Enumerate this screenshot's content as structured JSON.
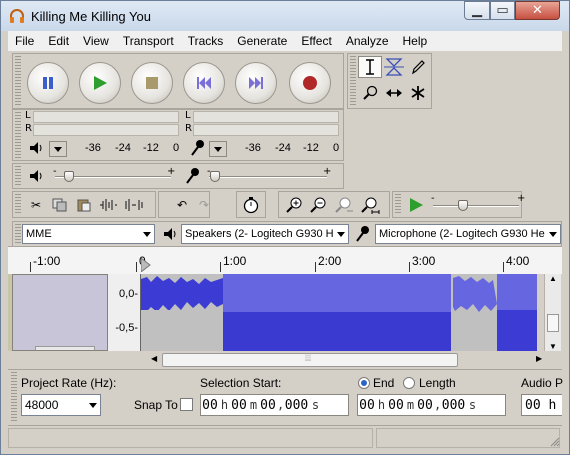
{
  "window": {
    "title": "Killing Me Killing You"
  },
  "menu": [
    "File",
    "Edit",
    "View",
    "Transport",
    "Tracks",
    "Generate",
    "Effect",
    "Analyze",
    "Help"
  ],
  "meters": {
    "play_L": "L",
    "play_R": "R",
    "rec_L": "L",
    "rec_R": "R",
    "play_scale": [
      "-36",
      "-24",
      "-12",
      "0"
    ],
    "rec_scale": [
      "-36",
      "-24",
      "-12",
      "0"
    ]
  },
  "mixer": {
    "output_volume_fraction": 0.12,
    "input_volume_fraction": 0.05,
    "minus": "-",
    "plus": "+"
  },
  "devices": {
    "host": "MME",
    "output": "Speakers (2- Logitech G930 He",
    "input": "Microphone (2- Logitech G930 He"
  },
  "play_at_speed": {
    "speed_fraction": 0.35,
    "minus": "-",
    "plus": "+"
  },
  "ruler": {
    "labels": [
      "-1:00",
      "0",
      "1:00",
      "2:00",
      "3:00",
      "4:00"
    ]
  },
  "track": {
    "y_labels": [
      "0,0-",
      "-0,5-"
    ]
  },
  "selection_toolbar": {
    "project_rate_label": "Project Rate (Hz):",
    "project_rate_value": "48000",
    "snap_to_label": "Snap To",
    "selection_start_label": "Selection Start:",
    "end_label": "End",
    "length_label": "Length",
    "audio_position_label": "Audio P",
    "start_time": [
      "00",
      "h",
      "00",
      "m",
      "00",
      ",",
      "000",
      "s"
    ],
    "end_time": [
      "00",
      "h",
      "00",
      "m",
      "00",
      ",",
      "000",
      "s"
    ],
    "audio_time": "00 h"
  },
  "colors": {
    "waveform": "#3c3cd4",
    "waveform_selected": "#6666e0",
    "selection_bg": "#c0c0c0"
  }
}
